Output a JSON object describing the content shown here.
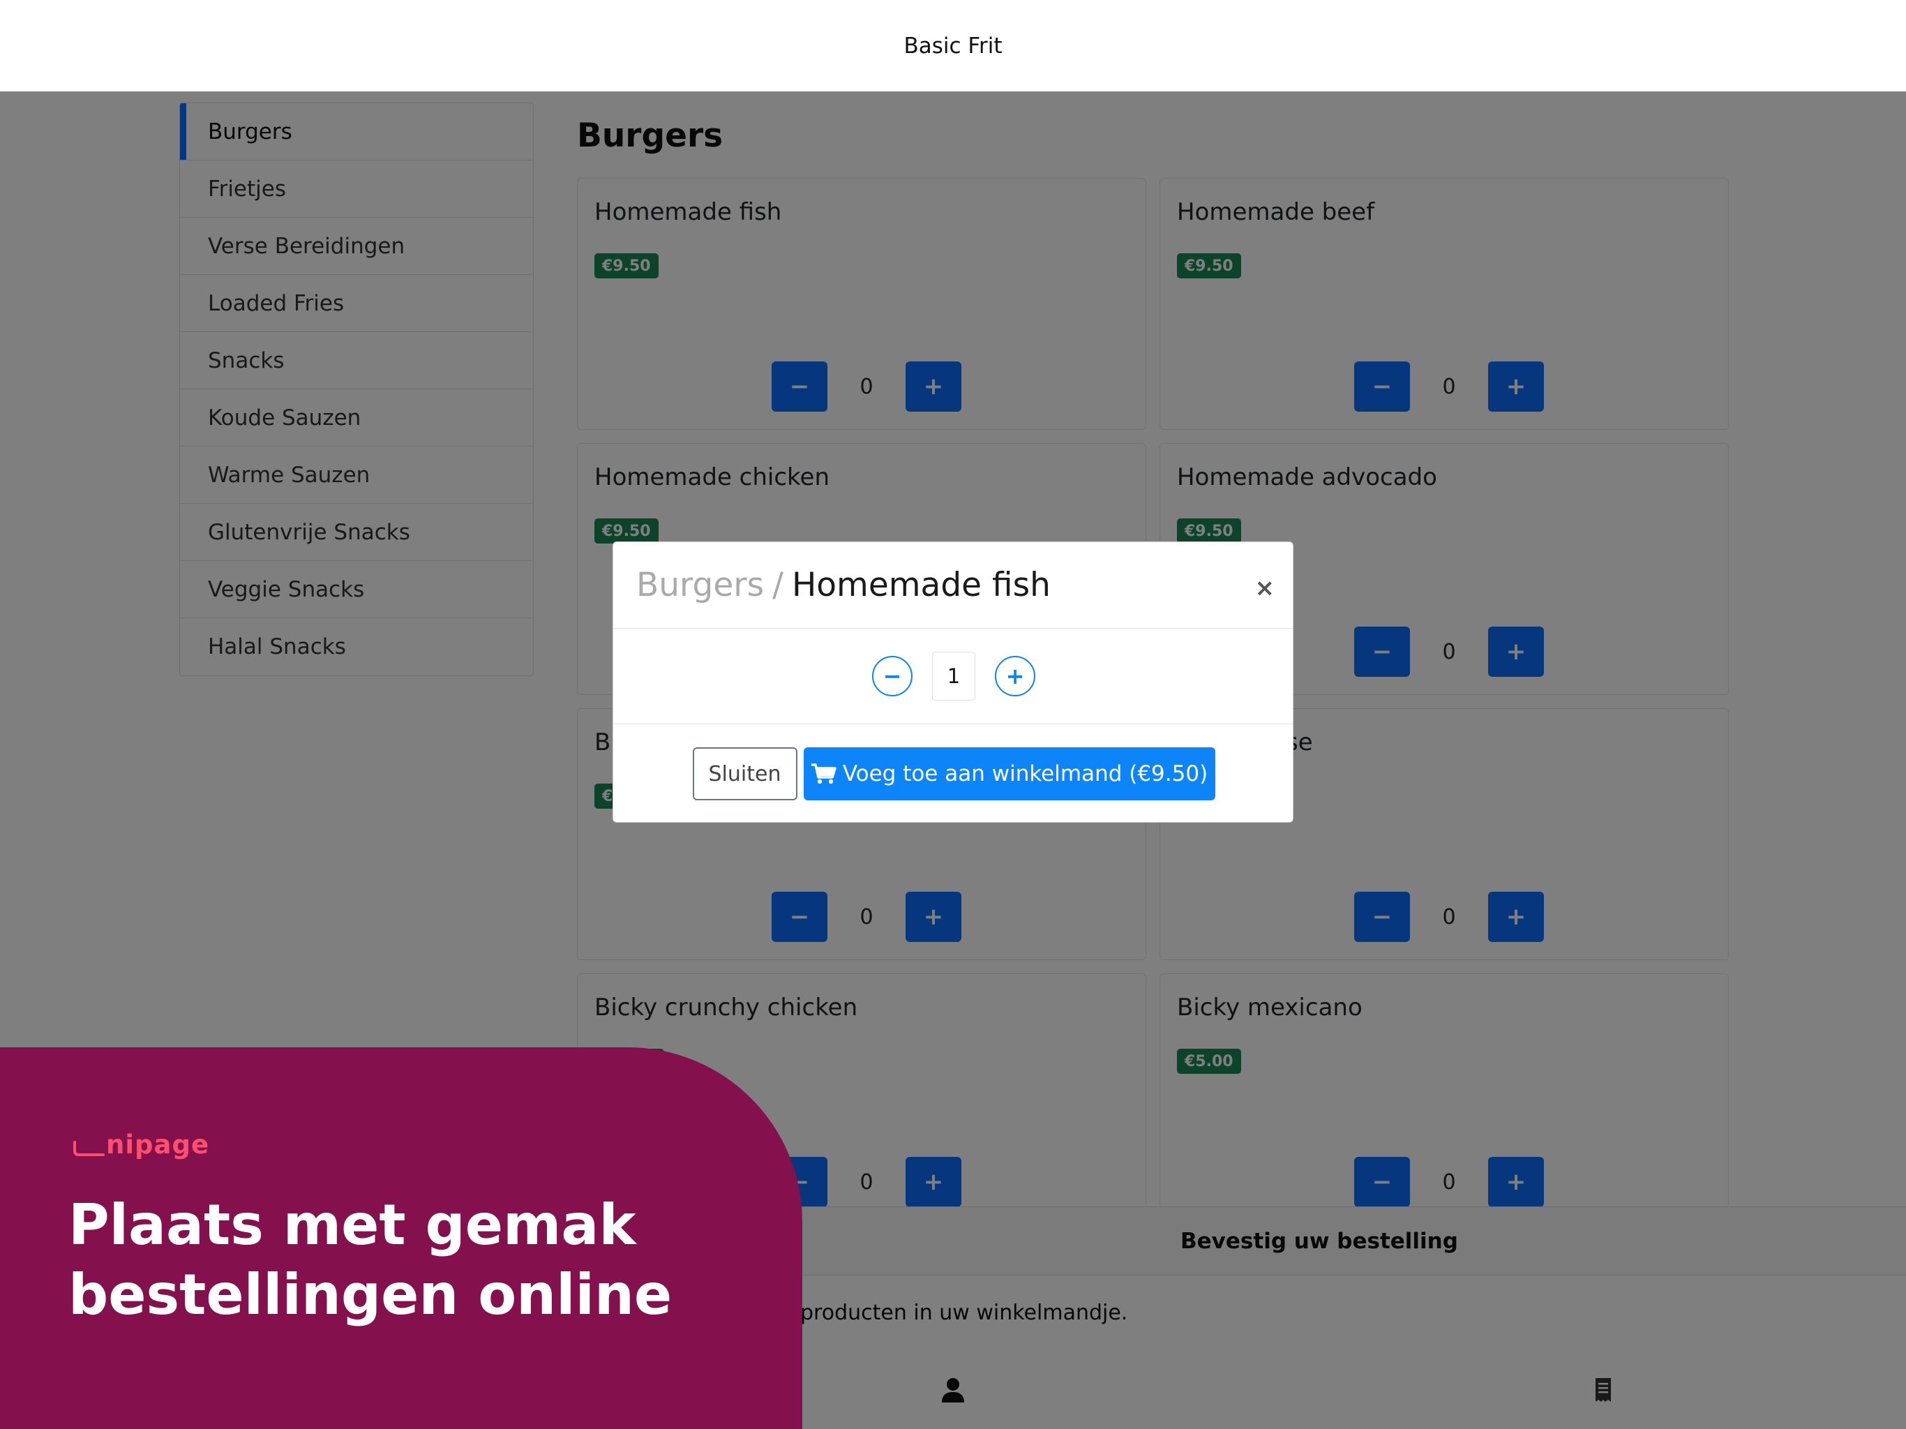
{
  "header": {
    "title": "Basic Frit"
  },
  "sidebar": {
    "items": [
      {
        "label": "Burgers"
      },
      {
        "label": "Frietjes"
      },
      {
        "label": "Verse Bereidingen"
      },
      {
        "label": "Loaded Fries"
      },
      {
        "label": "Snacks"
      },
      {
        "label": "Koude Sauzen"
      },
      {
        "label": "Warme Sauzen"
      },
      {
        "label": "Glutenvrije Snacks"
      },
      {
        "label": "Veggie Snacks"
      },
      {
        "label": "Halal Snacks"
      }
    ],
    "active": "Burgers"
  },
  "content": {
    "section_title": "Burgers",
    "products": [
      {
        "name": "Homemade fish",
        "price": "€9.50",
        "qty": "0"
      },
      {
        "name": "Homemade beef",
        "price": "€9.50",
        "qty": "0"
      },
      {
        "name": "Homemade chicken",
        "price": "€9.50",
        "qty": "0"
      },
      {
        "name": "Homemade advocado",
        "price": "€9.50",
        "qty": "0"
      },
      {
        "name": "Bi",
        "price": "€",
        "qty": "0"
      },
      {
        "name": "se",
        "price": "",
        "qty": "0"
      },
      {
        "name": "Bicky crunchy chicken",
        "price": "",
        "qty": "0"
      },
      {
        "name": "Bicky mexicano",
        "price": "€5.00",
        "qty": "0"
      }
    ],
    "minus_symbol": "−",
    "plus_symbol": "+"
  },
  "order": {
    "title": "Bevestig uw bestelling",
    "message": "en producten in uw winkelmandje."
  },
  "modal": {
    "breadcrumb": "Burgers",
    "separator": "/",
    "title": "Homemade fish",
    "close_symbol": "×",
    "quantity": "1",
    "minus_symbol": "−",
    "plus_symbol": "+",
    "close_button": "Sluiten",
    "add_button": "Voeg toe aan winkelmand (€9.50)"
  },
  "promo": {
    "brand": "nipage",
    "line1": "Plaats met gemak",
    "line2": "bestellingen online"
  },
  "colors": {
    "primary": "#0d6efd",
    "price_badge": "#198754",
    "promo_bg": "#84104d",
    "brand": "#ff4f6e"
  }
}
